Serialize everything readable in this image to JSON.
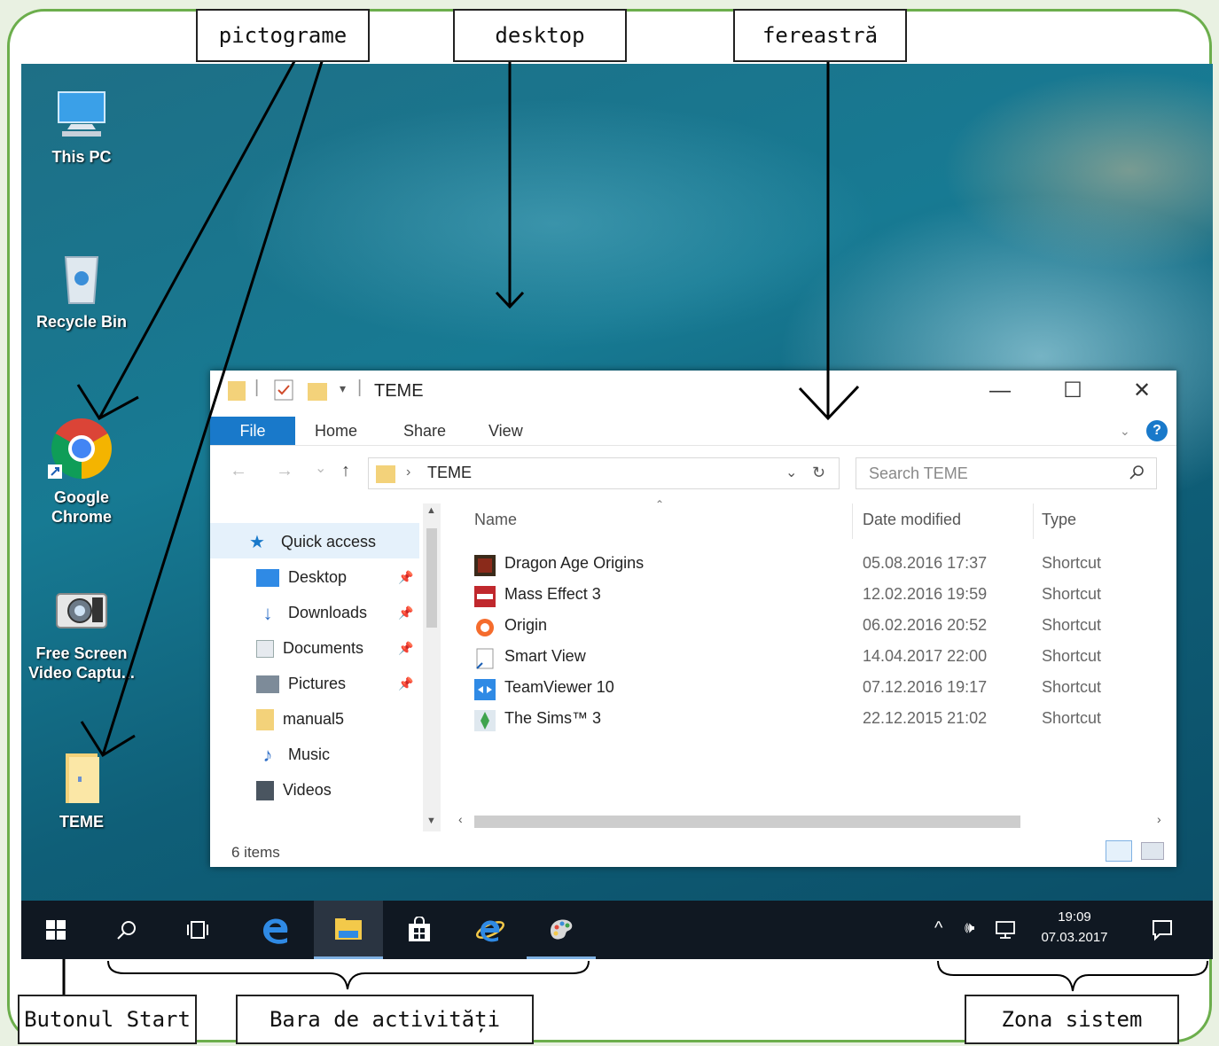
{
  "labels": {
    "icons": "pictograme",
    "desktop": "desktop",
    "window": "fereastră",
    "start_button": "Butonul Start",
    "taskbar": "Bara de activități",
    "system_zone": "Zona sistem"
  },
  "desktop_icons": [
    {
      "label_line1": "This PC",
      "label_line2": "",
      "icon": "computer-icon"
    },
    {
      "label_line1": "Recycle Bin",
      "label_line2": "",
      "icon": "recycle-bin-icon"
    },
    {
      "label_line1": "Google",
      "label_line2": "Chrome",
      "icon": "chrome-icon"
    },
    {
      "label_line1": "Free Screen",
      "label_line2": "Video Captu...",
      "icon": "camera-icon"
    },
    {
      "label_line1": "TEME",
      "label_line2": "",
      "icon": "folder-icon"
    }
  ],
  "explorer": {
    "title": "TEME",
    "title_separator": "|",
    "window_buttons": {
      "minimize": "—",
      "maximize": "☐",
      "close": "✕"
    },
    "ribbon_tabs": [
      "File",
      "Home",
      "Share",
      "View"
    ],
    "breadcrumb": "TEME",
    "breadcrumb_chevron": "›",
    "search_placeholder": "Search TEME",
    "nav_arrows": {
      "back": "←",
      "forward": "→",
      "recent": "⌄",
      "up": "↑"
    },
    "nav_items": [
      {
        "label": "Quick access",
        "pinned": false
      },
      {
        "label": "Desktop",
        "pinned": true
      },
      {
        "label": "Downloads",
        "pinned": true
      },
      {
        "label": "Documents",
        "pinned": true
      },
      {
        "label": "Pictures",
        "pinned": true
      },
      {
        "label": "manual5",
        "pinned": false
      },
      {
        "label": "Music",
        "pinned": false
      },
      {
        "label": "Videos",
        "pinned": false
      }
    ],
    "columns": {
      "name": "Name",
      "date": "Date modified",
      "type": "Type"
    },
    "files": [
      {
        "name": "Dragon Age Origins",
        "date": "05.08.2016 17:37",
        "type": "Shortcut",
        "icon": "dragon-age-icon"
      },
      {
        "name": "Mass Effect 3",
        "date": "12.02.2016 19:59",
        "type": "Shortcut",
        "icon": "mass-effect-icon"
      },
      {
        "name": "Origin",
        "date": "06.02.2016 20:52",
        "type": "Shortcut",
        "icon": "origin-icon"
      },
      {
        "name": "Smart View",
        "date": "14.04.2017 22:00",
        "type": "Shortcut",
        "icon": "smart-view-icon"
      },
      {
        "name": "TeamViewer 10",
        "date": "07.12.2016 19:17",
        "type": "Shortcut",
        "icon": "teamviewer-icon"
      },
      {
        "name": "The Sims™ 3",
        "date": "22.12.2015 21:02",
        "type": "Shortcut",
        "icon": "sims-icon"
      }
    ],
    "status": "6 items"
  },
  "taskbar": {
    "time": "19:09",
    "date": "07.03.2017",
    "tray_up": "^",
    "tray_volume": "🕪"
  },
  "colors": {
    "accent": "#1979ca",
    "frame": "#6cae4c",
    "taskbar": "#101822"
  }
}
